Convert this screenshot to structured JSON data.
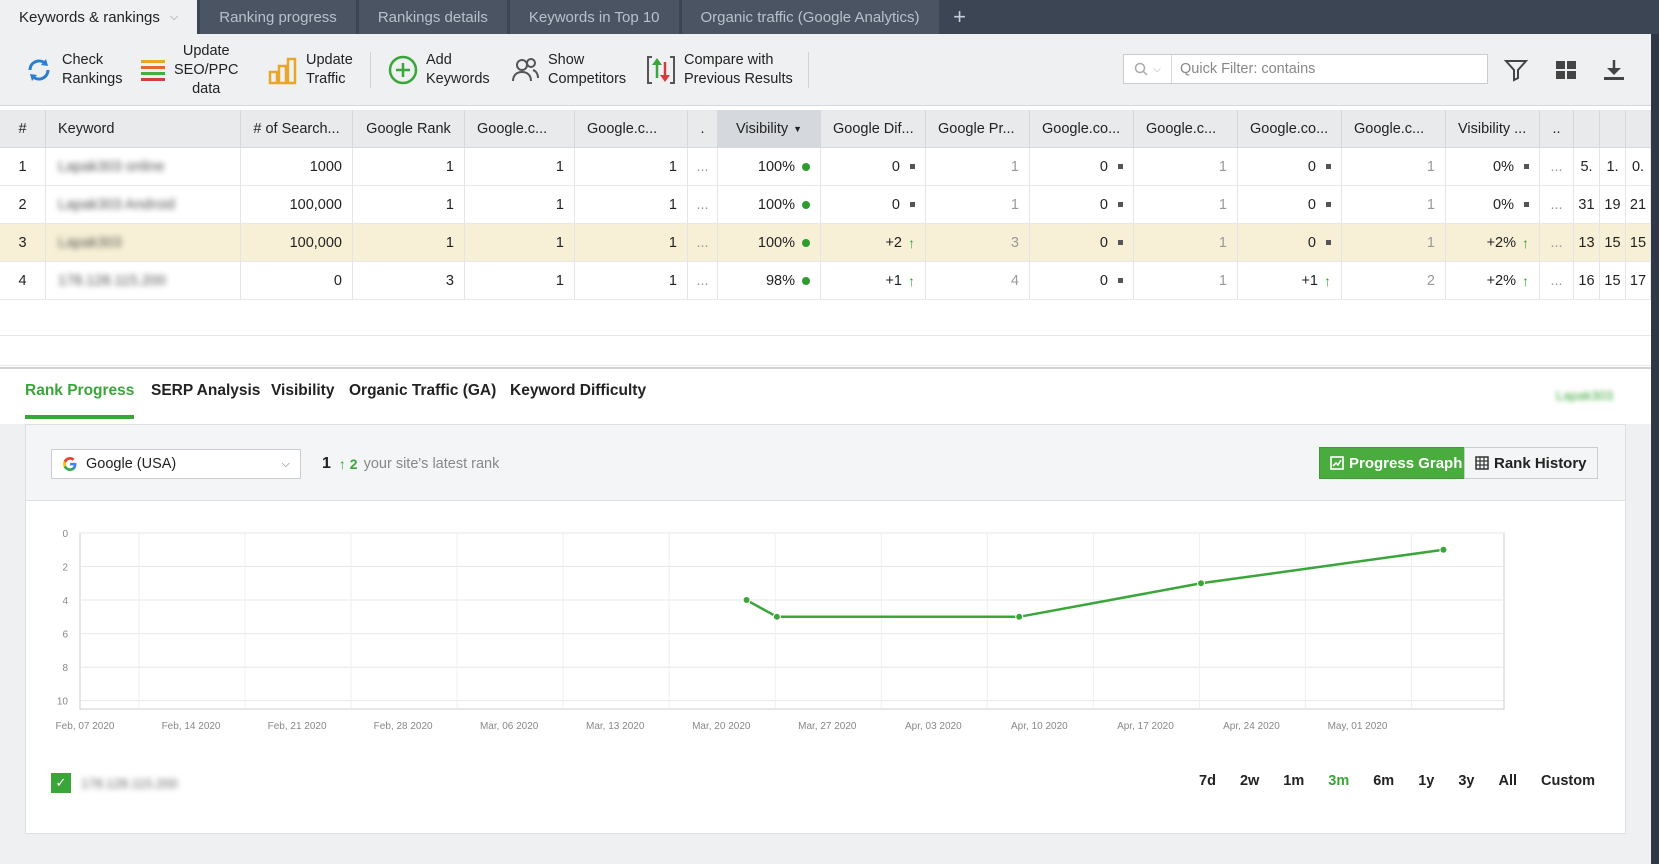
{
  "tabs": [
    {
      "label": "Keywords & rankings",
      "active": true
    },
    {
      "label": "Ranking progress"
    },
    {
      "label": "Rankings details"
    },
    {
      "label": "Keywords in Top 10"
    },
    {
      "label": "Organic traffic (Google Analytics)"
    }
  ],
  "tab_add": "+",
  "toolbar": {
    "check_rankings": "Check\nRankings",
    "update_seo": "Update\nSEO/PPC\ndata",
    "update_traffic": "Update\nTraffic",
    "add_keywords": "Add\nKeywords",
    "show_competitors": "Show\nCompetitors",
    "compare": "Compare with\nPrevious Results",
    "quick_filter_placeholder": "Quick Filter: contains"
  },
  "grid": {
    "headers": [
      "#",
      "Keyword",
      "# of Search...",
      "Google Rank",
      "Google.c...",
      "Google.c...",
      ".",
      "Visibility",
      "Google Dif...",
      "Google Pr...",
      "Google.co...",
      "Google.c...",
      "Google.co...",
      "Google.c...",
      "Visibility ...",
      "..",
      "",
      "",
      ""
    ],
    "rows": [
      {
        "num": "1",
        "keyword": "Lapak303 online",
        "searches": "1000",
        "rank": "1",
        "gc1": "1",
        "gc2": "1",
        "dots": "...",
        "visibility": "100%",
        "diff": "0",
        "pr": "1",
        "co1": "0",
        "c2": "1",
        "co3": "0",
        "c4": "1",
        "vis2": "0%",
        "dots2": "...",
        "x1": "5.",
        "x2": "1.",
        "x3": "0."
      },
      {
        "num": "2",
        "keyword": "Lapak303 Android",
        "searches": "100,000",
        "rank": "1",
        "gc1": "1",
        "gc2": "1",
        "dots": "...",
        "visibility": "100%",
        "diff": "0",
        "pr": "1",
        "co1": "0",
        "c2": "1",
        "co3": "0",
        "c4": "1",
        "vis2": "0%",
        "dots2": "...",
        "x1": "31",
        "x2": "19",
        "x3": "21"
      },
      {
        "num": "3",
        "keyword": "Lapak303",
        "searches": "100,000",
        "rank": "1",
        "gc1": "1",
        "gc2": "1",
        "dots": "...",
        "visibility": "100%",
        "diff": "+2",
        "pr": "3",
        "co1": "0",
        "c2": "1",
        "co3": "0",
        "c4": "1",
        "vis2": "+2%",
        "dots2": "...",
        "x1": "13",
        "x2": "15",
        "x3": "15"
      },
      {
        "num": "4",
        "keyword": "178.128.115.200",
        "searches": "0",
        "rank": "3",
        "gc1": "1",
        "gc2": "1",
        "dots": "...",
        "visibility": "98%",
        "diff": "+1",
        "pr": "4",
        "co1": "0",
        "c2": "1",
        "co3": "+1",
        "c4": "2",
        "vis2": "+2%",
        "dots2": "...",
        "x1": "16",
        "x2": "15",
        "x3": "17"
      }
    ]
  },
  "subtabs": [
    "Rank Progress",
    "SERP Analysis",
    "Visibility",
    "Organic Traffic (GA)",
    "Keyword Difficulty"
  ],
  "site_name": "Lapak303",
  "panel": {
    "engine": "Google (USA)",
    "latest_rank": "1",
    "rank_change": "2",
    "rank_note": "your site's latest rank",
    "progress_graph": "Progress Graph",
    "rank_history": "Rank History",
    "legend_label": "178.128.115.200",
    "ranges": [
      "7d",
      "2w",
      "1m",
      "3m",
      "6m",
      "1y",
      "3y",
      "All",
      "Custom"
    ],
    "active_range": "3m"
  },
  "chart_data": {
    "type": "line",
    "x_ticks": [
      "Feb, 07 2020",
      "Feb, 14 2020",
      "Feb, 21 2020",
      "Feb, 28 2020",
      "Mar, 06 2020",
      "Mar, 13 2020",
      "Mar, 20 2020",
      "Mar, 27 2020",
      "Apr, 03 2020",
      "Apr, 10 2020",
      "Apr, 17 2020",
      "Apr, 24 2020",
      "May, 01 2020"
    ],
    "y_ticks": [
      "0",
      "2",
      "4",
      "6",
      "8",
      "10"
    ],
    "ylim": [
      0,
      10.5
    ],
    "y_inverted": true,
    "series": [
      {
        "points": [
          {
            "x": "2020-03-22",
            "y": 4
          },
          {
            "x": "2020-03-24",
            "y": 5
          },
          {
            "x": "2020-04-09",
            "y": 5
          },
          {
            "x": "2020-04-21",
            "y": 3
          },
          {
            "x": "2020-05-07",
            "y": 1
          }
        ],
        "color": "#3aa63a"
      }
    ]
  }
}
